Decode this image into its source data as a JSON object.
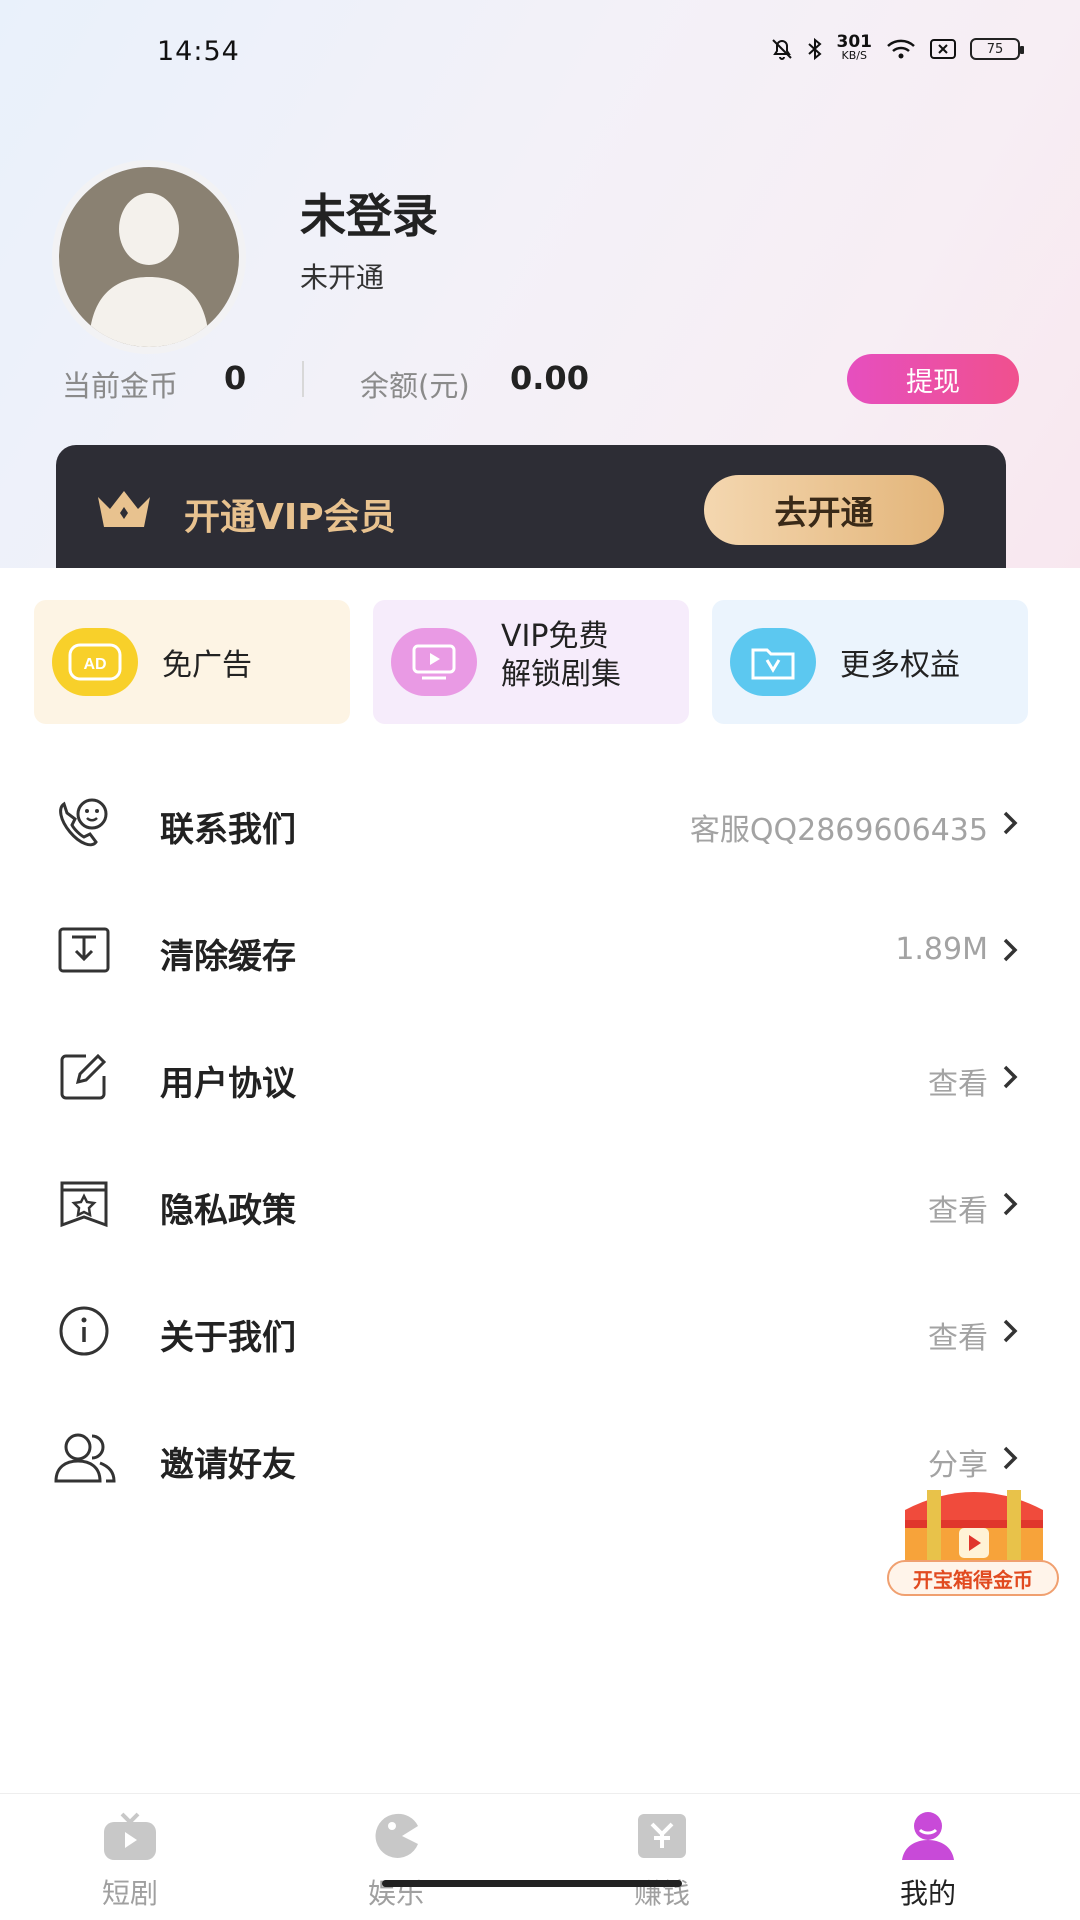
{
  "status_bar": {
    "time": "14:54",
    "net_speed_value": "301",
    "net_speed_unit": "KB/S",
    "battery": "75"
  },
  "profile": {
    "name": "未登录",
    "membership_status": "未开通",
    "coins_label": "当前金币",
    "coins_value": "0",
    "balance_label": "余额(元)",
    "balance_value": "0.00",
    "withdraw_label": "提现"
  },
  "vip_banner": {
    "title": "开通VIP会员",
    "button_label": "去开通",
    "accent_color": "#e8c28f"
  },
  "benefits": [
    {
      "label": "免广告",
      "icon": "ad-icon"
    },
    {
      "label_line1": "VIP免费",
      "label_line2": "解锁剧集",
      "icon": "tv-play-icon"
    },
    {
      "label": "更多权益",
      "icon": "vip-folder-icon"
    }
  ],
  "menu": [
    {
      "label": "联系我们",
      "value": "客服QQ2869606435",
      "icon": "phone-smile-icon"
    },
    {
      "label": "清除缓存",
      "value": "1.89M",
      "icon": "clear-cache-icon"
    },
    {
      "label": "用户协议",
      "value": "查看",
      "icon": "edit-document-icon"
    },
    {
      "label": "隐私政策",
      "value": "查看",
      "icon": "privacy-star-icon"
    },
    {
      "label": "关于我们",
      "value": "查看",
      "icon": "info-icon"
    },
    {
      "label": "邀请好友",
      "value": "分享",
      "icon": "friends-icon"
    }
  ],
  "treasure": {
    "label": "开宝箱得金币"
  },
  "bottom_nav": [
    {
      "label": "短剧",
      "icon": "tv-icon",
      "active": false
    },
    {
      "label": "娱乐",
      "icon": "game-icon",
      "active": false
    },
    {
      "label": "赚钱",
      "icon": "wallet-icon",
      "active": false
    },
    {
      "label": "我的",
      "icon": "profile-icon",
      "active": true
    }
  ],
  "colors": {
    "withdraw_gradient": [
      "#e64fbf",
      "#f0508e"
    ],
    "active_nav": "#222222",
    "active_nav_icon": "#c84ad8"
  }
}
